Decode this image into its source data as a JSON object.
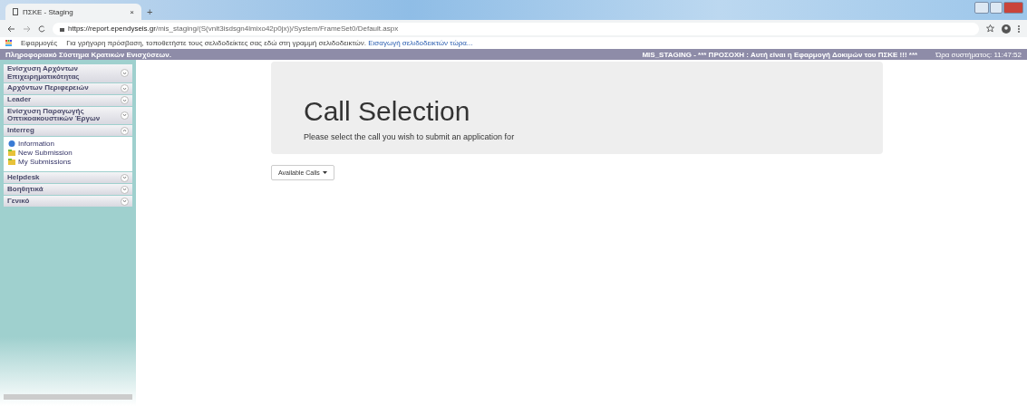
{
  "browser": {
    "tab_title": "ΠΣΚΕ - Staging",
    "tab_close": "×",
    "new_tab": "+",
    "url_host": "https://report.ependyseis.gr",
    "url_path": "/mis_staging/(S(vnlt3isdsgn4lmixo42p0jx))/System/FrameSet0/Default.aspx",
    "apps_label": "Εφαρμογές",
    "bookmarks_hint": "Για γρήγορη πρόσβαση, τοποθετήστε τους σελιδοδείκτες σας εδώ στη γραμμή σελιδοδεικτών.",
    "bookmarks_link": "Εισαγωγή σελιδοδεικτών τώρα..."
  },
  "header": {
    "title": "Πληροφοριακό Σύστημα Κρατικών Ενισχύσεων.",
    "warning": "MIS_STAGING - *** ΠΡΟΣΟΧΗ : Αυτή είναι η Εφαρμογή Δοκιμών του ΠΣΚΕ !!! ***",
    "clock": "Ώρα συστήματος: 11:47:52"
  },
  "sidebar": {
    "sections": [
      {
        "label": "Ενίσχυση Αρχόντων Επιχειρηματικότητας",
        "expanded": false
      },
      {
        "label": "Αρχόντων Περιφερειών",
        "expanded": false
      },
      {
        "label": "Leader",
        "expanded": false
      },
      {
        "label": "Ενίσχυση Παραγωγής Οπτικοακουστικών Έργων",
        "expanded": false
      },
      {
        "label": "Interreg",
        "expanded": true,
        "children": [
          {
            "label": "Information",
            "kind": "info"
          },
          {
            "label": "New Submission",
            "kind": "folder"
          },
          {
            "label": "My Submissions",
            "kind": "folder"
          }
        ]
      },
      {
        "label": "Helpdesk",
        "expanded": false
      },
      {
        "label": "Βοηθητικά",
        "expanded": false
      },
      {
        "label": "Γενικό",
        "expanded": false
      }
    ]
  },
  "jumbotron": {
    "title": "Call Selection",
    "text": "Please select the call you wish to submit an application for"
  },
  "dropdown": {
    "label": "Available Calls"
  }
}
